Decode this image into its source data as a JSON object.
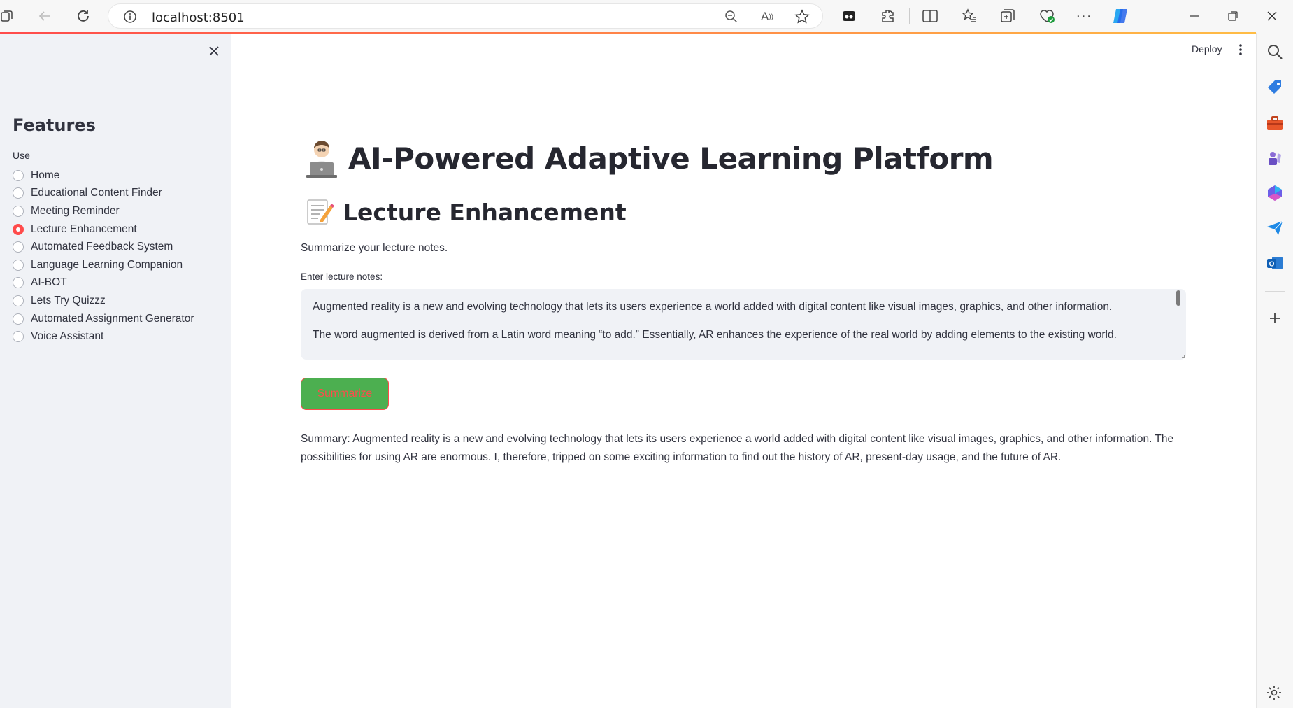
{
  "browser": {
    "url": "localhost:8501",
    "accent_gradient": [
      "#ff4b4b",
      "#ffbd45"
    ]
  },
  "app_header": {
    "deploy_label": "Deploy"
  },
  "sidebar": {
    "title": "Features",
    "radio_group_label": "Use",
    "items": [
      {
        "label": "Home",
        "selected": false
      },
      {
        "label": "Educational Content Finder",
        "selected": false
      },
      {
        "label": "Meeting Reminder",
        "selected": false
      },
      {
        "label": "Lecture Enhancement",
        "selected": true
      },
      {
        "label": "Automated Feedback System",
        "selected": false
      },
      {
        "label": "Language Learning Companion",
        "selected": false
      },
      {
        "label": "AI-BOT",
        "selected": false
      },
      {
        "label": "Lets Try Quizzz",
        "selected": false
      },
      {
        "label": "Automated Assignment Generator",
        "selected": false
      },
      {
        "label": "Voice Assistant",
        "selected": false
      }
    ],
    "selected_color": "#ff4b4b"
  },
  "main": {
    "title": "AI-Powered Adaptive Learning Platform",
    "title_icon": "technologist-emoji-icon",
    "section_title": "Lecture Enhancement",
    "section_icon": "memo-emoji-icon",
    "description": "Summarize your lecture notes.",
    "input_label": "Enter lecture notes:",
    "input_value_lines": [
      "Augmented reality is a new and evolving technology that lets its users experience a world added with digital content like visual images, graphics, and other information.",
      "The word augmented is derived from a Latin word meaning “to add.” Essentially, AR enhances the experience of the real world by adding elements to the existing world."
    ],
    "button_label": "Summarize",
    "button_bg": "#4caf50",
    "button_text_color": "#ff4b4b",
    "summary": "Summary: Augmented reality is a new and evolving technology that lets its users experience a world added with digital content like visual images, graphics, and other information. The possibilities for using AR are enormous. I, therefore, tripped on some exciting information to find out the history of AR, present-day usage, and the future of AR."
  }
}
